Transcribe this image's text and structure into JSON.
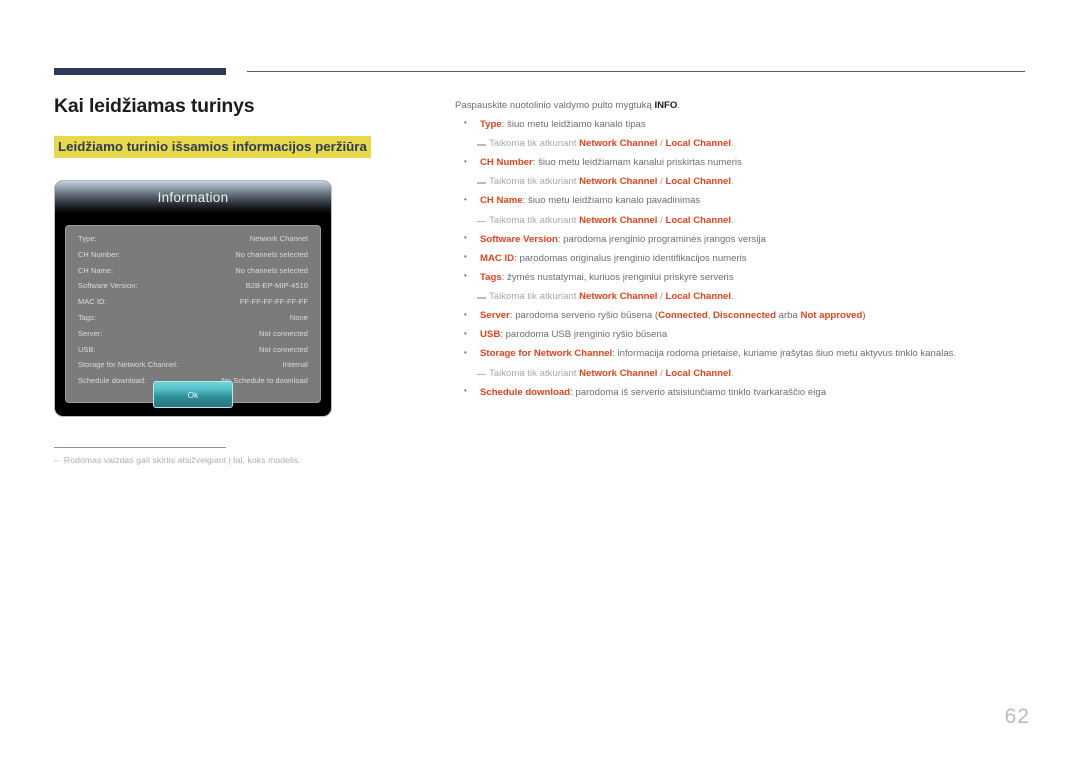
{
  "page": {
    "number": "62",
    "title": "Kai leidžiamas turinys",
    "subtitle": "Leidžiamo turinio išsamios informacijos peržiūra",
    "footnote_dash": "–",
    "footnote": "Rodomas vaizdas gali skirtis atsižvelgiant į tai, koks modelis.",
    "accent_navy": "#2e3a57",
    "accent_highlight": "#e8d94b",
    "accent_orange": "#e5431c"
  },
  "dialog": {
    "title": "Information",
    "ok_label": "Ok",
    "rows": [
      {
        "key": "Type:",
        "value": "Network Channel"
      },
      {
        "key": "CH Number:",
        "value": "No channels selected"
      },
      {
        "key": "CH Name:",
        "value": "No channels selected"
      },
      {
        "key": "Software Version:",
        "value": "B2B-EP-MIP-4510"
      },
      {
        "key": "MAC ID:",
        "value": "FF-FF-FF-FF-FF-FF"
      },
      {
        "key": "Tags:",
        "value": "None"
      },
      {
        "key": "Server:",
        "value": "Not connected"
      },
      {
        "key": "USB:",
        "value": "Not connected"
      },
      {
        "key": "Storage for Network Channel:",
        "value": "Internal"
      },
      {
        "key": "Schedule download:",
        "value": "No Schedule to download"
      }
    ]
  },
  "content": {
    "intro_before": "Paspauskite nuotolinio valdymo pulto mygtuką ",
    "intro_bold": "INFO",
    "intro_after": ".",
    "applies_prefix": "Taikoma tik atkuriant ",
    "network_channel": "Network Channel",
    "separator": " / ",
    "local_channel": "Local Channel",
    "applies_suffix": ".",
    "items": [
      {
        "label": "Type",
        "text": ": šiuo metu leidžiamo kanalo tipas",
        "has_subline": true
      },
      {
        "label": "CH Number",
        "text": ": šiuo metu leidžiamam kanalui priskirtas numeris",
        "has_subline": true
      },
      {
        "label": "CH Name",
        "text": ": šiuo metu leidžiamo kanalo pavadinimas",
        "has_subline": true
      },
      {
        "label": "Software Version",
        "text": ": parodoma įrenginio programinės įrangos versija",
        "has_subline": false
      },
      {
        "label": "MAC ID",
        "text": ": parodomas originalus įrenginio identifikacijos numeris",
        "has_subline": false
      },
      {
        "label": "Tags",
        "text": ": žymės nustatymai, kuriuos įrenginiui priskyrė serveris",
        "has_subline": true
      },
      {
        "label": "Server",
        "text": ": parodoma serverio ryšio būsena (",
        "has_subline": false,
        "inline_states": {
          "connected": "Connected",
          "comma": ", ",
          "disconnected": "Disconnected",
          "or": " arba ",
          "not_approved": "Not approved",
          "close": ")"
        }
      },
      {
        "label": "USB",
        "text": ": parodoma USB įrenginio ryšio būsena",
        "has_subline": false
      },
      {
        "label": "Storage for Network Channel",
        "text": ": informacija rodoma prietaise, kuriame įrašytas šiuo metu aktyvus tinklo kanalas.",
        "has_subline": true
      },
      {
        "label": "Schedule download",
        "text": ": parodoma iš serverio atsisiunčiamo tinklo tvarkaraščio eiga",
        "has_subline": false
      }
    ]
  }
}
